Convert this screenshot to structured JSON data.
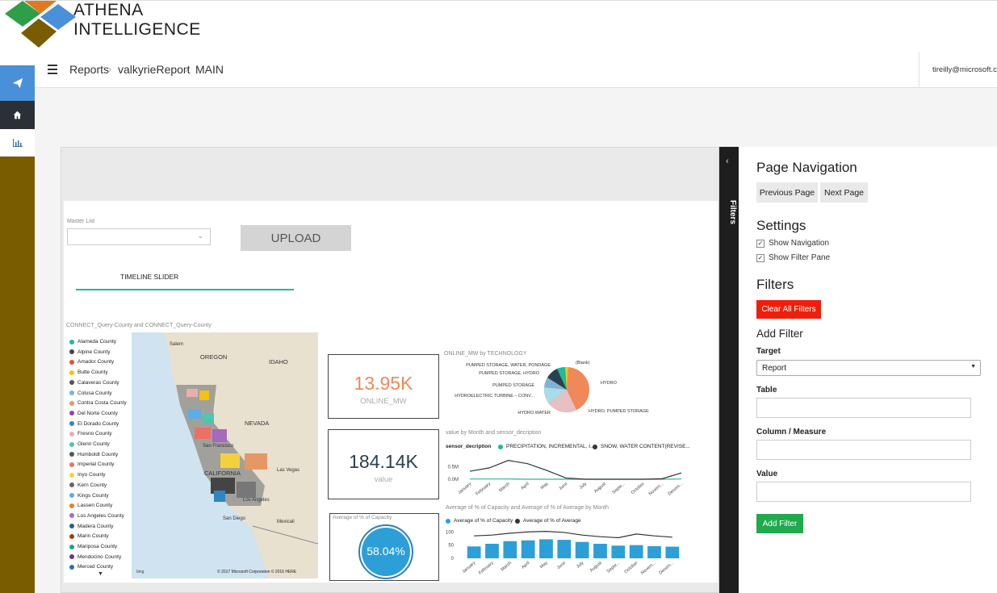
{
  "brand": {
    "line1": "ATHENA",
    "line2": "INTELLIGENCE"
  },
  "sidebar": {
    "items": [
      {
        "icon": "send-icon"
      },
      {
        "icon": "home-icon"
      },
      {
        "icon": "bar-chart-icon"
      }
    ]
  },
  "header": {
    "breadcrumb": [
      "Reports",
      "valkyrieReport",
      "MAIN"
    ],
    "user": "tireilly@microsoft.com"
  },
  "report": {
    "master_list_label": "Master List",
    "upload_label": "UPLOAD",
    "timeline_tab": "TIMELINE SLIDER",
    "map_title": "CONNECT_Query-County and CONNECT_Query-County",
    "map_counties": [
      "Alameda County",
      "Alpine County",
      "Amador County",
      "Butte County",
      "Calaveras County",
      "Colusa County",
      "Contra Costa County",
      "Del Norte County",
      "El Dorado County",
      "Fresno County",
      "Glenn County",
      "Humboldt County",
      "Imperial County",
      "Inyo County",
      "Kern County",
      "Kings County",
      "Lassen County",
      "Los Angeles County",
      "Madera County",
      "Marin County",
      "Mariposa County",
      "Mendocino County",
      "Merced County"
    ],
    "map_county_colors": [
      "#1abc9c",
      "#444444",
      "#e74c3c",
      "#f1c40f",
      "#555555",
      "#7fb3d5",
      "#e59866",
      "#8e44ad",
      "#2e86c1",
      "#e6b0aa",
      "#48c9b0",
      "#555555",
      "#ec7063",
      "#f4d03f",
      "#666666",
      "#5dade2",
      "#e67e22",
      "#a569bd",
      "#21618c",
      "#a04000",
      "#17a589",
      "#6c3483",
      "#2874a6"
    ],
    "map_places": [
      "Salem",
      "OREGON",
      "IDAHO",
      "NEVADA",
      "CALIFORNIA",
      "San Francisco",
      "Las Vegas",
      "Los Angeles",
      "San Diego",
      "Mexicali"
    ],
    "map_credit": "© 2017 Microsoft Corporation   © 2016 HERE",
    "map_bing": "bing",
    "kpi1": {
      "value": "13.95K",
      "label": "ONLINE_MW"
    },
    "kpi2": {
      "value": "184.14K",
      "label": "value"
    },
    "gauge": {
      "title": "Average of % of Capacity",
      "value": "58.04%",
      "fraction": 0.5804
    },
    "pie": {
      "title": "ONLINE_MW by TECHNOLOGY",
      "labels": [
        "PUMPED STORAGE, WATER, PONDAGE",
        "PUMPED STORAGE, HYDRO",
        "PUMPED STORAGE",
        "HYDROELECTRIC TURBINE – CONV...",
        "HYDRO.WATER",
        "(Blank)",
        "HYDRO",
        "HYDRO, PUMPED STORAGE"
      ]
    },
    "line": {
      "title": "value by Month and sensor_decription",
      "legend_title": "sensor_decription",
      "series_names": [
        "PRECIPITATION, INCREMENTAL, I...",
        "SNOW, WATER CONTENT(REVISE..."
      ],
      "y_ticks": [
        "0.5M",
        "0.0M"
      ]
    },
    "combo": {
      "title": "Average of % of Capacity and Average of % of Average by Month",
      "series_names": [
        "Average of % of Capacity",
        "Average of % of Average"
      ],
      "y_ticks": [
        "100",
        "50",
        "0"
      ]
    },
    "months": [
      "January",
      "February",
      "March",
      "April",
      "May",
      "June",
      "July",
      "August",
      "Septe...",
      "October",
      "Novem...",
      "Decem..."
    ]
  },
  "filters_tab": "Filters",
  "pane": {
    "page_nav_title": "Page Navigation",
    "prev_label": "Previous Page",
    "next_label": "Next Page",
    "settings_title": "Settings",
    "show_navigation": "Show Navigation",
    "show_filter_pane": "Show Filter Pane",
    "filters_title": "Filters",
    "clear_label": "Clear All Filters",
    "add_filter_title": "Add Filter",
    "target_label": "Target",
    "target_value": "Report",
    "table_label": "Table",
    "column_label": "Column / Measure",
    "value_label": "Value",
    "add_button": "Add Filter"
  },
  "chart_data": [
    {
      "type": "line",
      "title": "value by Month and sensor_decription",
      "categories": [
        "January",
        "February",
        "March",
        "April",
        "May",
        "June",
        "July",
        "August",
        "Septe...",
        "October",
        "Novem...",
        "Decem..."
      ],
      "series": [
        {
          "name": "PRECIPITATION, INCREMENTAL, I...",
          "values": [
            0.01,
            0.01,
            0.01,
            0.0,
            0.0,
            0.0,
            0.0,
            0.0,
            0.0,
            0.0,
            0.0,
            0.01
          ]
        },
        {
          "name": "SNOW, WATER CONTENT(REVISE...",
          "values": [
            0.32,
            0.45,
            0.75,
            0.62,
            0.35,
            0.05,
            0.0,
            0.0,
            0.0,
            0.0,
            0.02,
            0.25
          ]
        }
      ],
      "ylim": [
        0,
        0.9
      ],
      "color": [
        "#1abc9c",
        "#333333"
      ]
    },
    {
      "type": "bar",
      "title": "Average of % of Capacity and Average of % of Average by Month",
      "categories": [
        "January",
        "February",
        "March",
        "April",
        "May",
        "June",
        "July",
        "August",
        "Septe...",
        "October",
        "Novem...",
        "Decem..."
      ],
      "series": [
        {
          "name": "Average of % of Capacity",
          "values": [
            45,
            55,
            65,
            68,
            72,
            70,
            62,
            55,
            48,
            50,
            46,
            44
          ]
        },
        {
          "name": "Average of % of Average",
          "values": [
            85,
            88,
            95,
            100,
            102,
            98,
            88,
            82,
            78,
            92,
            85,
            80
          ]
        }
      ],
      "ylim": [
        0,
        110
      ],
      "color": [
        "#2c9fd9",
        "#333333"
      ]
    }
  ]
}
